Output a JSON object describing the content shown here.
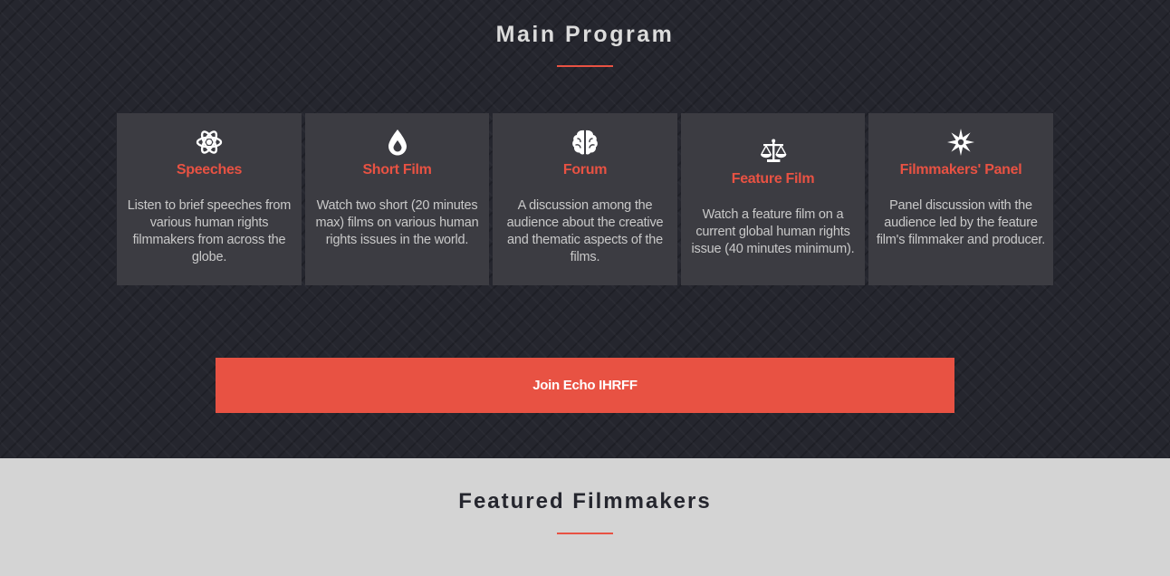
{
  "main_program": {
    "title": "Main Program",
    "accent_color": "#e85243",
    "cards": [
      {
        "icon": "atom-icon",
        "title": "Speeches",
        "text": "Listen to brief speeches from various human rights filmmakers from across the globe."
      },
      {
        "icon": "drop-icon",
        "title": "Short Film",
        "text": "Watch two short (20 minutes max) films on various human rights issues in the world."
      },
      {
        "icon": "brain-icon",
        "title": "Forum",
        "text": "A discussion among the audience about the creative and thematic aspects of the films."
      },
      {
        "icon": "balance-scale-icon",
        "title": "Feature Film",
        "text": "Watch a feature film on a current global human rights issue (40 minutes minimum)."
      },
      {
        "icon": "starburst-icon",
        "title": "Filmmakers' Panel",
        "text": "Panel discussion with the audience led by the feature film's filmmaker and producer."
      }
    ],
    "join_button_label": "Join Echo IHRFF"
  },
  "featured_filmmakers": {
    "title": "Featured Filmmakers"
  }
}
